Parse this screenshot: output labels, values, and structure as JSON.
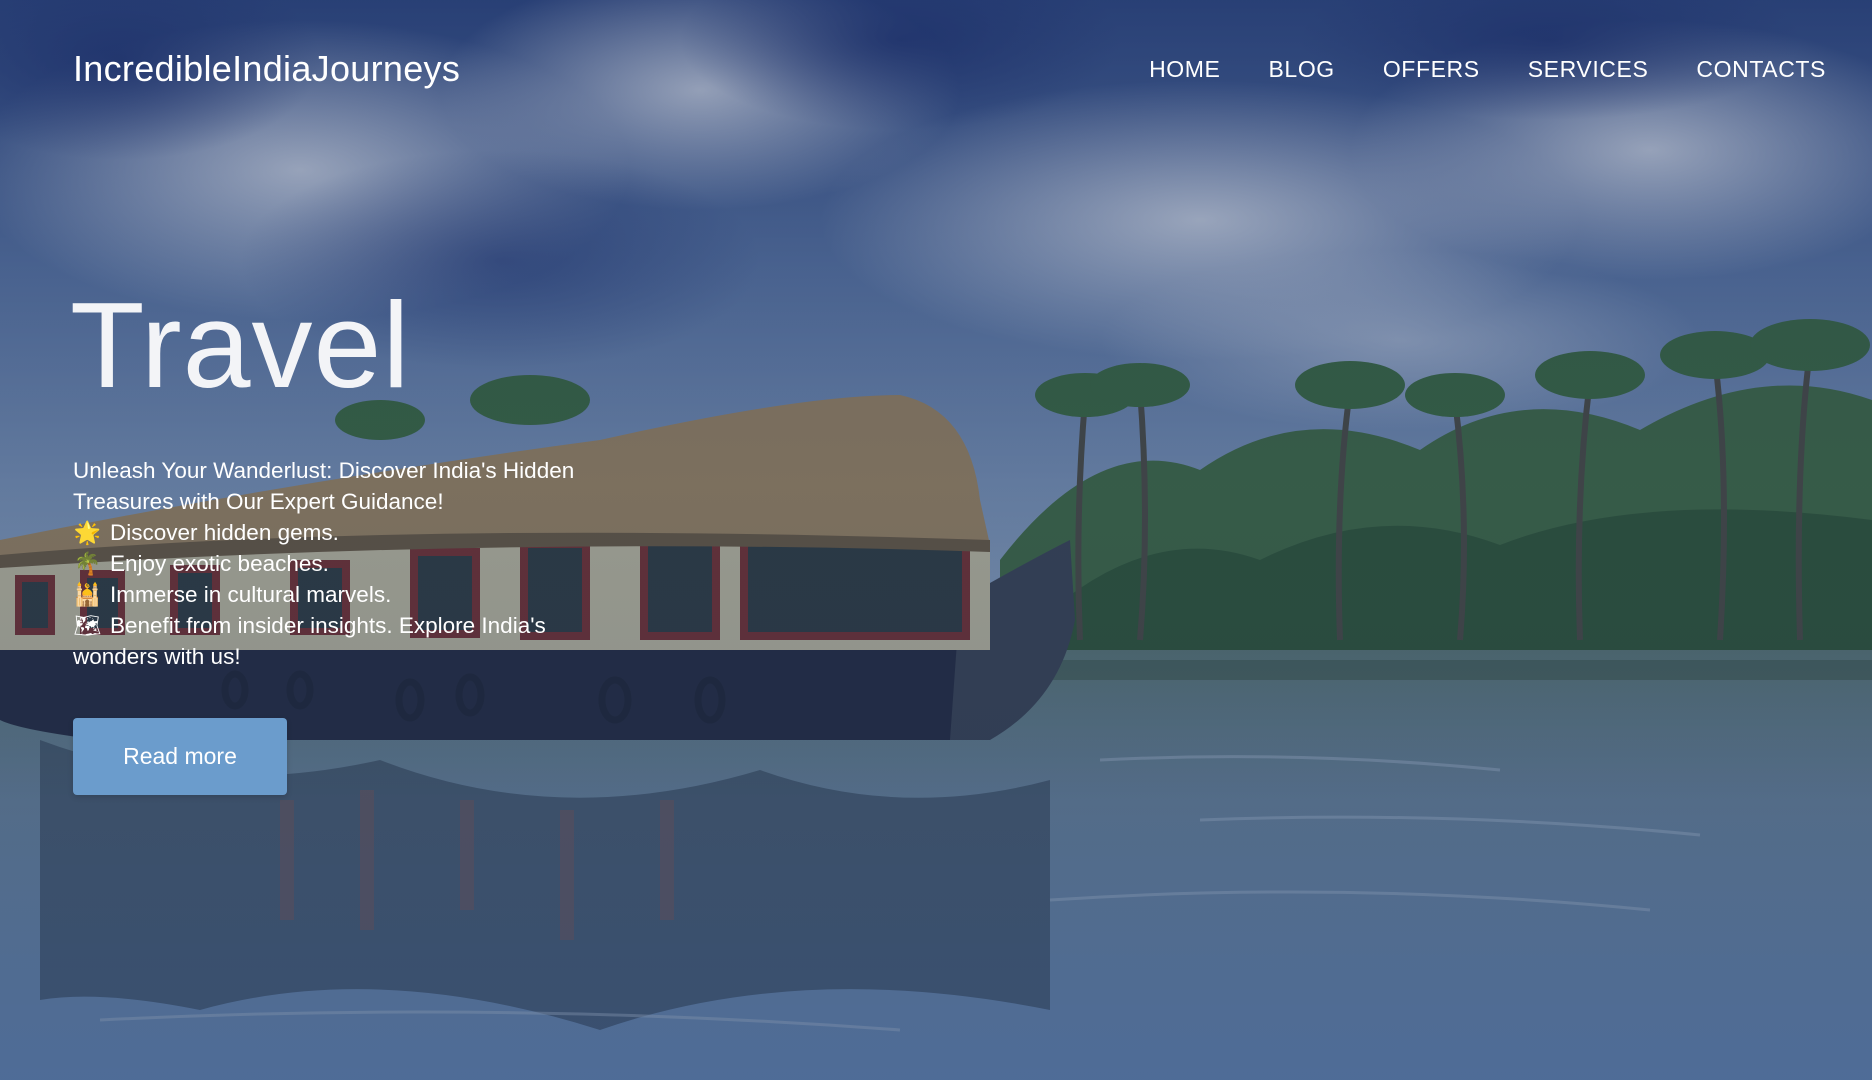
{
  "header": {
    "logo": "IncredibleIndiaJourneys",
    "nav": [
      "HOME",
      "BLOG",
      "OFFERS",
      "SERVICES",
      "CONTACTS"
    ]
  },
  "hero": {
    "title": "Travel",
    "tagline": "Unleash Your Wanderlust: Discover India's Hidden Treasures with Our Expert Guidance!",
    "items": [
      {
        "icon": "star-icon",
        "glyph": "🌟",
        "text": "Discover hidden gems."
      },
      {
        "icon": "palm-tree-icon",
        "glyph": "🌴",
        "text": "Enjoy exotic beaches."
      },
      {
        "icon": "temple-icon",
        "glyph": "🕌",
        "text": "Immerse in cultural marvels."
      },
      {
        "icon": "map-icon",
        "glyph": "🗺",
        "text": "Benefit from insider insights. Explore India's wonders with us!"
      }
    ],
    "button_label": "Read more"
  },
  "colors": {
    "button": "#6b9ccc",
    "text": "#ffffff"
  }
}
